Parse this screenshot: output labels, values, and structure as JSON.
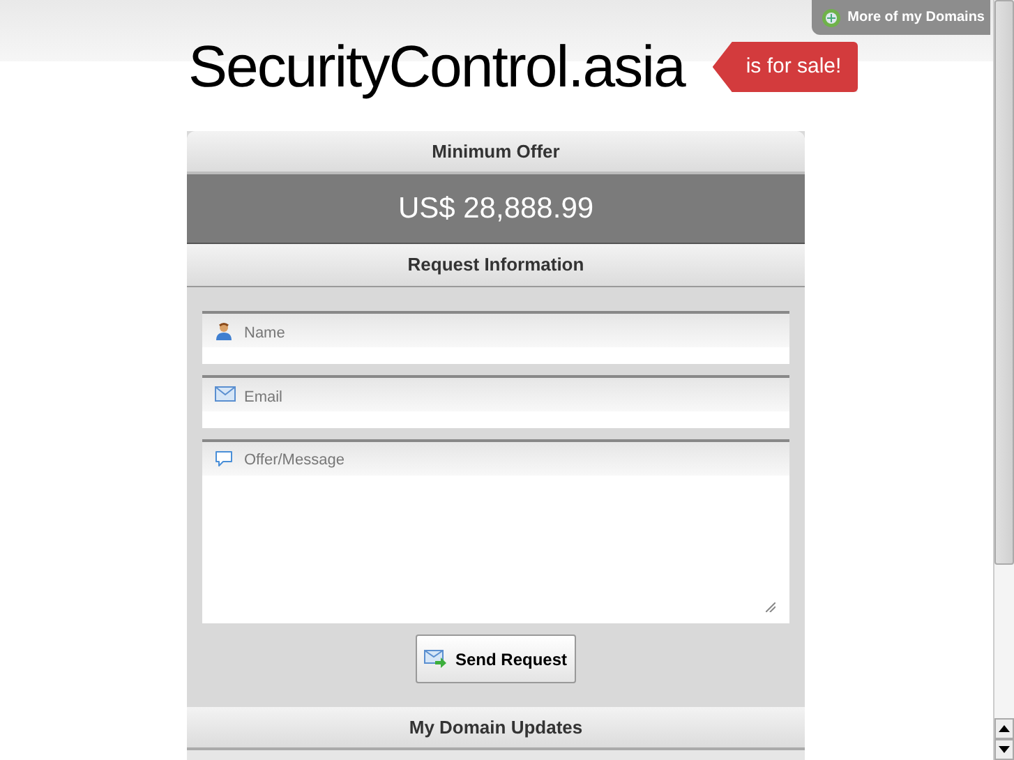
{
  "top_link": {
    "label": "More of my Domains"
  },
  "domain": "SecurityControl.asia",
  "sale_tag": "is for sale!",
  "offer": {
    "heading": "Minimum Offer",
    "price": "US$ 28,888.99"
  },
  "request": {
    "heading": "Request Information",
    "fields": [
      {
        "kind": "person",
        "placeholder": "Name"
      },
      {
        "kind": "mail",
        "placeholder": "Email"
      },
      {
        "kind": "chat",
        "placeholder": "Offer/Message"
      }
    ],
    "button": "Send Request"
  },
  "updates": {
    "heading": "My Domain Updates"
  }
}
